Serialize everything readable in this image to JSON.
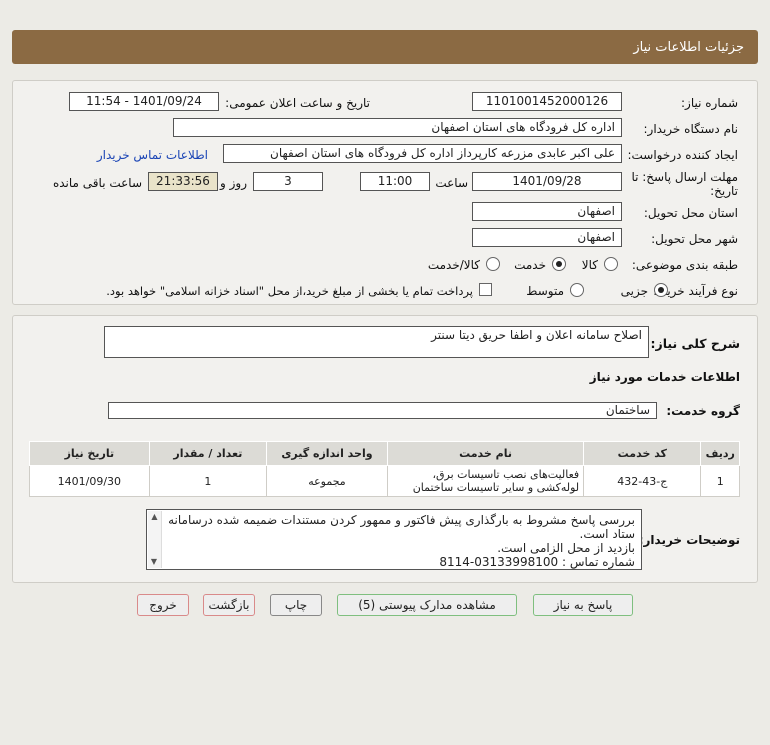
{
  "header": {
    "title": "جزئیات اطلاعات نیاز"
  },
  "fields": {
    "need_number_label": "شماره نیاز:",
    "need_number": "1101001452000126",
    "announce_label": "تاریخ و ساعت اعلان عمومی:",
    "announce_value": "1401/09/24 - 11:54",
    "buyer_org_label": "نام دستگاه خریدار:",
    "buyer_org": "اداره کل فرودگاه های استان اصفهان",
    "creator_label": "ایجاد کننده درخواست:",
    "creator": "علی اکبر عابدی مزرعه کارپرداز اداره کل فرودگاه های استان اصفهان",
    "contact_link": "اطلاعات تماس خریدار",
    "deadline_label_1": "مهلت ارسال پاسخ: تا",
    "deadline_label_2": "تاریخ:",
    "deadline_date": "1401/09/28",
    "time_label": "ساعت",
    "deadline_time": "11:00",
    "days_value": "3",
    "days_label": "روز و",
    "remaining_time": "21:33:56",
    "remaining_label": "ساعت باقی مانده",
    "delivery_place_label": "استان محل تحویل:",
    "delivery_place": "اصفهان",
    "delivery_city_label": "شهر محل تحویل:",
    "delivery_city": "اصفهان",
    "category_label": "طبقه بندی موضوعی:",
    "category_options": [
      "کالا",
      "خدمت",
      "کالا/خدمت"
    ],
    "purchase_type_label": "نوع فرآیند خرید :",
    "purchase_options": [
      "جزیی",
      "متوسط"
    ],
    "payment_note": "پرداخت تمام یا بخشی از مبلغ خرید،از محل \"اسناد خزانه اسلامی\" خواهد بود."
  },
  "description": {
    "label": "شرح کلی نیاز:",
    "value": "اصلاح سامانه اعلان و اطفا حریق دیتا سنتر"
  },
  "services": {
    "section_title": "اطلاعات خدمات مورد نیاز",
    "group_label": "گروه خدمت:",
    "group_value": "ساختمان"
  },
  "table": {
    "headers": [
      "ردیف",
      "کد خدمت",
      "نام خدمت",
      "واحد اندازه گیری",
      "تعداد / مقدار",
      "تاریخ نیاز"
    ],
    "rows": [
      [
        "1",
        "ج-43-432",
        "فعالیت‌های نصب تاسیسات برق، لوله‌کشی و سایر تاسیسات ساختمان",
        "مجموعه",
        "1",
        "1401/09/30"
      ]
    ]
  },
  "buyer_notes": {
    "label": "توضیحات خریدار:",
    "lines": [
      "بررسی پاسخ مشروط  به بارگذاری پیش فاکتور و ممهور کردن مستندات ضمیمه شده درسامانه ستاد است.",
      "بازدید از محل الزامی است.",
      "شماره تماس : 03133998100-8114"
    ]
  },
  "buttons": {
    "reply": "پاسخ به نیاز",
    "view_docs": "مشاهده مدارک پیوستی (5)",
    "print": "چاپ",
    "back": "بازگشت",
    "exit": "خروج"
  }
}
